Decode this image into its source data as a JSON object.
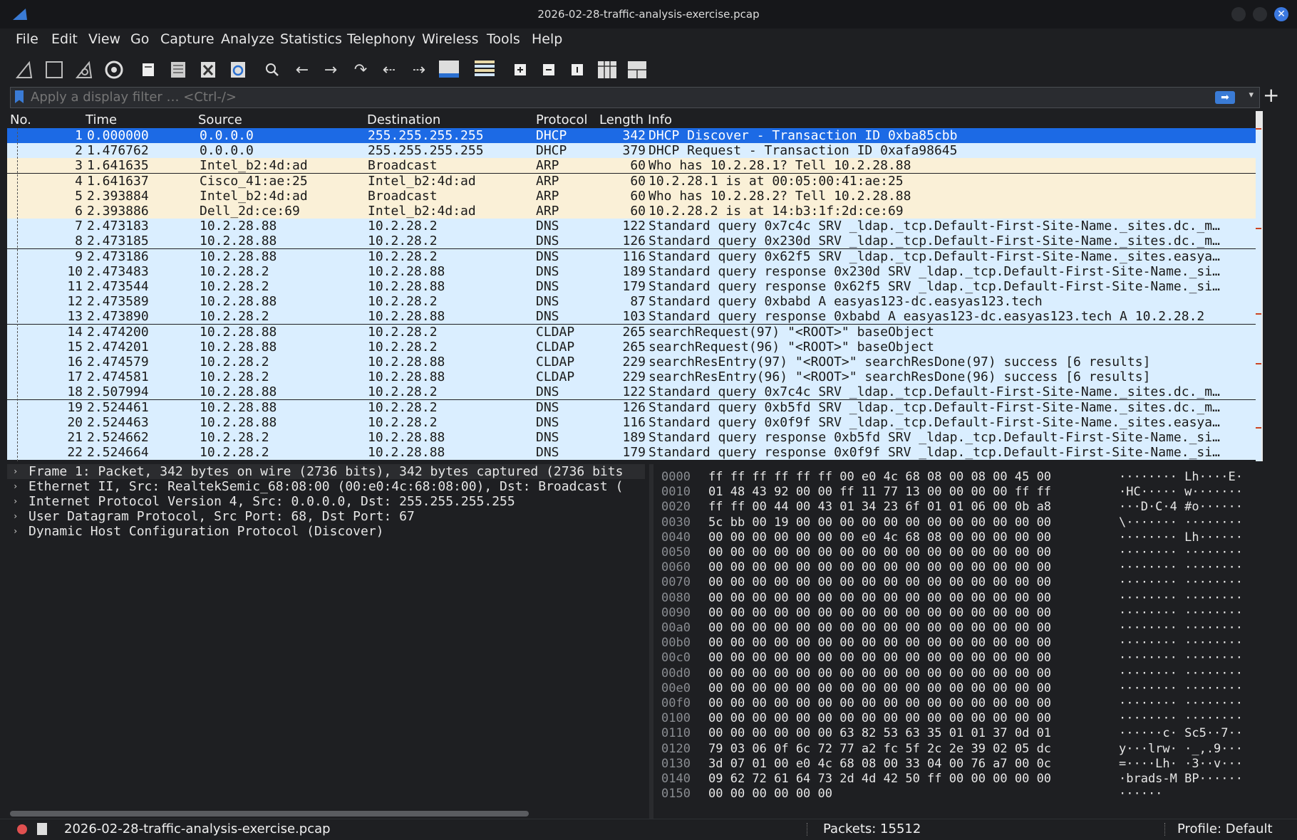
{
  "window": {
    "title": "2026-02-28-traffic-analysis-exercise.pcap"
  },
  "menu": [
    "File",
    "Edit",
    "View",
    "Go",
    "Capture",
    "Analyze",
    "Statistics",
    "Telephony",
    "Wireless",
    "Tools",
    "Help"
  ],
  "filter": {
    "placeholder": "Apply a display filter … <Ctrl-/>"
  },
  "columns": {
    "no": "No.",
    "time": "Time",
    "source": "Source",
    "destination": "Destination",
    "protocol": "Protocol",
    "length": "Length",
    "info": "Info"
  },
  "packets": [
    {
      "no": "1",
      "time": "0.000000",
      "src": "0.0.0.0",
      "dst": "255.255.255.255",
      "proto": "DHCP",
      "len": "342",
      "info": "DHCP Discover - Transaction ID 0xba85cbb"
    },
    {
      "no": "2",
      "time": "1.476762",
      "src": "0.0.0.0",
      "dst": "255.255.255.255",
      "proto": "DHCP",
      "len": "379",
      "info": "DHCP Request  - Transaction ID 0xafa98645"
    },
    {
      "no": "3",
      "time": "1.641635",
      "src": "Intel_b2:4d:ad",
      "dst": "Broadcast",
      "proto": "ARP",
      "len": "60",
      "info": "Who has 10.2.28.1? Tell 10.2.28.88"
    },
    {
      "no": "4",
      "time": "1.641637",
      "src": "Cisco_41:ae:25",
      "dst": "Intel_b2:4d:ad",
      "proto": "ARP",
      "len": "60",
      "info": "10.2.28.1 is at 00:05:00:41:ae:25"
    },
    {
      "no": "5",
      "time": "2.393884",
      "src": "Intel_b2:4d:ad",
      "dst": "Broadcast",
      "proto": "ARP",
      "len": "60",
      "info": "Who has 10.2.28.2? Tell 10.2.28.88"
    },
    {
      "no": "6",
      "time": "2.393886",
      "src": "Dell_2d:ce:69",
      "dst": "Intel_b2:4d:ad",
      "proto": "ARP",
      "len": "60",
      "info": "10.2.28.2 is at 14:b3:1f:2d:ce:69"
    },
    {
      "no": "7",
      "time": "2.473183",
      "src": "10.2.28.88",
      "dst": "10.2.28.2",
      "proto": "DNS",
      "len": "122",
      "info": "Standard query 0x7c4c SRV _ldap._tcp.Default-First-Site-Name._sites.dc._m…"
    },
    {
      "no": "8",
      "time": "2.473185",
      "src": "10.2.28.88",
      "dst": "10.2.28.2",
      "proto": "DNS",
      "len": "126",
      "info": "Standard query 0x230d SRV _ldap._tcp.Default-First-Site-Name._sites.dc._m…"
    },
    {
      "no": "9",
      "time": "2.473186",
      "src": "10.2.28.88",
      "dst": "10.2.28.2",
      "proto": "DNS",
      "len": "116",
      "info": "Standard query 0x62f5 SRV _ldap._tcp.Default-First-Site-Name._sites.easya…"
    },
    {
      "no": "10",
      "time": "2.473483",
      "src": "10.2.28.2",
      "dst": "10.2.28.88",
      "proto": "DNS",
      "len": "189",
      "info": "Standard query response 0x230d SRV _ldap._tcp.Default-First-Site-Name._si…"
    },
    {
      "no": "11",
      "time": "2.473544",
      "src": "10.2.28.2",
      "dst": "10.2.28.88",
      "proto": "DNS",
      "len": "179",
      "info": "Standard query response 0x62f5 SRV _ldap._tcp.Default-First-Site-Name._si…"
    },
    {
      "no": "12",
      "time": "2.473589",
      "src": "10.2.28.88",
      "dst": "10.2.28.2",
      "proto": "DNS",
      "len": "87",
      "info": "Standard query 0xbabd A easyas123-dc.easyas123.tech"
    },
    {
      "no": "13",
      "time": "2.473890",
      "src": "10.2.28.2",
      "dst": "10.2.28.88",
      "proto": "DNS",
      "len": "103",
      "info": "Standard query response 0xbabd A easyas123-dc.easyas123.tech A 10.2.28.2"
    },
    {
      "no": "14",
      "time": "2.474200",
      "src": "10.2.28.88",
      "dst": "10.2.28.2",
      "proto": "CLDAP",
      "len": "265",
      "info": "searchRequest(97) \"<ROOT>\" baseObject"
    },
    {
      "no": "15",
      "time": "2.474201",
      "src": "10.2.28.88",
      "dst": "10.2.28.2",
      "proto": "CLDAP",
      "len": "265",
      "info": "searchRequest(96) \"<ROOT>\" baseObject"
    },
    {
      "no": "16",
      "time": "2.474579",
      "src": "10.2.28.2",
      "dst": "10.2.28.88",
      "proto": "CLDAP",
      "len": "229",
      "info": "searchResEntry(97) \"<ROOT>\" searchResDone(97) success  [6 results]"
    },
    {
      "no": "17",
      "time": "2.474581",
      "src": "10.2.28.2",
      "dst": "10.2.28.88",
      "proto": "CLDAP",
      "len": "229",
      "info": "searchResEntry(96) \"<ROOT>\" searchResDone(96) success  [6 results]"
    },
    {
      "no": "18",
      "time": "2.507994",
      "src": "10.2.28.88",
      "dst": "10.2.28.2",
      "proto": "DNS",
      "len": "122",
      "info": "Standard query 0x7c4c SRV _ldap._tcp.Default-First-Site-Name._sites.dc._m…"
    },
    {
      "no": "19",
      "time": "2.524461",
      "src": "10.2.28.88",
      "dst": "10.2.28.2",
      "proto": "DNS",
      "len": "126",
      "info": "Standard query 0xb5fd SRV _ldap._tcp.Default-First-Site-Name._sites.dc._m…"
    },
    {
      "no": "20",
      "time": "2.524463",
      "src": "10.2.28.88",
      "dst": "10.2.28.2",
      "proto": "DNS",
      "len": "116",
      "info": "Standard query 0x0f9f SRV _ldap._tcp.Default-First-Site-Name._sites.easya…"
    },
    {
      "no": "21",
      "time": "2.524662",
      "src": "10.2.28.2",
      "dst": "10.2.28.88",
      "proto": "DNS",
      "len": "189",
      "info": "Standard query response 0xb5fd SRV _ldap._tcp.Default-First-Site-Name._si…"
    },
    {
      "no": "22",
      "time": "2.524664",
      "src": "10.2.28.2",
      "dst": "10.2.28.88",
      "proto": "DNS",
      "len": "179",
      "info": "Standard query response 0x0f9f SRV _ldap._tcp.Default-First-Site-Name._si…"
    }
  ],
  "details": [
    "Frame 1: Packet, 342 bytes on wire (2736 bits), 342 bytes captured (2736 bits",
    "Ethernet II, Src: RealtekSemic_68:08:00 (00:e0:4c:68:08:00), Dst: Broadcast (",
    "Internet Protocol Version 4, Src: 0.0.0.0, Dst: 255.255.255.255",
    "User Datagram Protocol, Src Port: 68, Dst Port: 67",
    "Dynamic Host Configuration Protocol (Discover)"
  ],
  "hex": [
    {
      "off": "0000",
      "bytes": "ff ff ff ff ff ff 00 e0  4c 68 08 00 08 00 45 00",
      "ascii": "········ Lh····E·"
    },
    {
      "off": "0010",
      "bytes": "01 48 43 92 00 00 ff 11  77 13 00 00 00 00 ff ff",
      "ascii": "·HC····· w·······"
    },
    {
      "off": "0020",
      "bytes": "ff ff 00 44 00 43 01 34  23 6f 01 01 06 00 0b a8",
      "ascii": "···D·C·4 #o······"
    },
    {
      "off": "0030",
      "bytes": "5c bb 00 19 00 00 00 00  00 00 00 00 00 00 00 00",
      "ascii": "\\······· ········"
    },
    {
      "off": "0040",
      "bytes": "00 00 00 00 00 00 00 e0  4c 68 08 00 00 00 00 00",
      "ascii": "········ Lh······"
    },
    {
      "off": "0050",
      "bytes": "00 00 00 00 00 00 00 00  00 00 00 00 00 00 00 00",
      "ascii": "········ ········"
    },
    {
      "off": "0060",
      "bytes": "00 00 00 00 00 00 00 00  00 00 00 00 00 00 00 00",
      "ascii": "········ ········"
    },
    {
      "off": "0070",
      "bytes": "00 00 00 00 00 00 00 00  00 00 00 00 00 00 00 00",
      "ascii": "········ ········"
    },
    {
      "off": "0080",
      "bytes": "00 00 00 00 00 00 00 00  00 00 00 00 00 00 00 00",
      "ascii": "········ ········"
    },
    {
      "off": "0090",
      "bytes": "00 00 00 00 00 00 00 00  00 00 00 00 00 00 00 00",
      "ascii": "········ ········"
    },
    {
      "off": "00a0",
      "bytes": "00 00 00 00 00 00 00 00  00 00 00 00 00 00 00 00",
      "ascii": "········ ········"
    },
    {
      "off": "00b0",
      "bytes": "00 00 00 00 00 00 00 00  00 00 00 00 00 00 00 00",
      "ascii": "········ ········"
    },
    {
      "off": "00c0",
      "bytes": "00 00 00 00 00 00 00 00  00 00 00 00 00 00 00 00",
      "ascii": "········ ········"
    },
    {
      "off": "00d0",
      "bytes": "00 00 00 00 00 00 00 00  00 00 00 00 00 00 00 00",
      "ascii": "········ ········"
    },
    {
      "off": "00e0",
      "bytes": "00 00 00 00 00 00 00 00  00 00 00 00 00 00 00 00",
      "ascii": "········ ········"
    },
    {
      "off": "00f0",
      "bytes": "00 00 00 00 00 00 00 00  00 00 00 00 00 00 00 00",
      "ascii": "········ ········"
    },
    {
      "off": "0100",
      "bytes": "00 00 00 00 00 00 00 00  00 00 00 00 00 00 00 00",
      "ascii": "········ ········"
    },
    {
      "off": "0110",
      "bytes": "00 00 00 00 00 00 63 82  53 63 35 01 01 37 0d 01",
      "ascii": "······c· Sc5··7··"
    },
    {
      "off": "0120",
      "bytes": "79 03 06 0f 6c 72 77 a2  fc 5f 2c 2e 39 02 05 dc",
      "ascii": "y···lrw· ·_,.9···"
    },
    {
      "off": "0130",
      "bytes": "3d 07 01 00 e0 4c 68 08  00 33 04 00 76 a7 00 0c",
      "ascii": "=····Lh· ·3··v···"
    },
    {
      "off": "0140",
      "bytes": "09 62 72 61 64 73 2d 4d  42 50 ff 00 00 00 00 00",
      "ascii": "·brads-M BP······"
    },
    {
      "off": "0150",
      "bytes": "00 00 00 00 00 00",
      "ascii": "······"
    }
  ],
  "status": {
    "file": "2026-02-28-traffic-analysis-exercise.pcap",
    "packets": "Packets: 15512",
    "profile": "Profile: Default"
  },
  "colors": {
    "selected": "#1c6ae5",
    "arp": "#faf0d7",
    "udp": "#daeeff",
    "accent": "#3a7bd5"
  },
  "toolbar_icons": [
    "shark-fin-start-icon",
    "stop-square-icon",
    "shark-fin-restart-icon",
    "gear-options-icon",
    "open-file-icon",
    "save-file-icon",
    "close-file-icon",
    "reload-file-icon",
    "search-icon",
    "arrow-left-icon",
    "arrow-right-icon",
    "jump-to-icon",
    "first-packet-icon",
    "last-packet-icon",
    "autoscroll-icon",
    "colorize-icon",
    "zoom-in-icon",
    "zoom-out-icon",
    "normal-size-icon",
    "resize-columns-icon",
    "layout-icon"
  ]
}
